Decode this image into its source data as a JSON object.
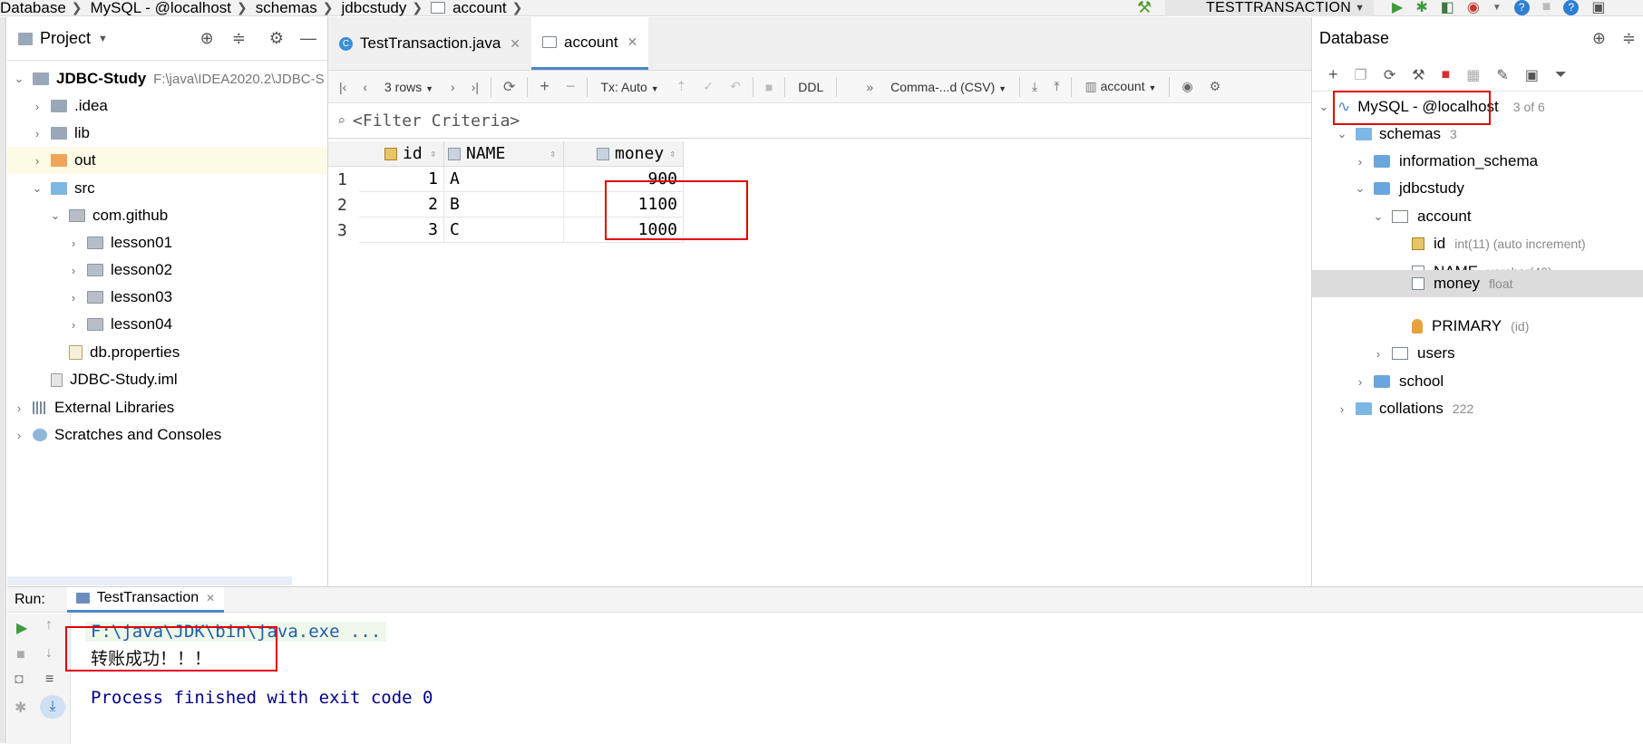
{
  "breadcrumb": [
    "Database",
    "MySQL - @localhost",
    "schemas",
    "jdbcstudy",
    "account"
  ],
  "run_config": {
    "name": "TESTTRANSACTION"
  },
  "project": {
    "title": "Project",
    "root": {
      "label": "JDBC-Study",
      "path": "F:\\java\\IDEA2020.2\\JDBC-S"
    },
    "items": [
      ".idea",
      "lib",
      "out",
      "src",
      "com.github",
      "lesson01",
      "lesson02",
      "lesson03",
      "lesson04",
      "db.properties",
      "JDBC-Study.iml",
      "External Libraries",
      "Scratches and Consoles"
    ]
  },
  "editor": {
    "tabs": [
      "TestTransaction.java",
      "account"
    ],
    "toolbar": {
      "rows": "3 rows",
      "tx": "Tx: Auto",
      "ddl": "DDL",
      "format": "Comma-...d (CSV)",
      "table": "account"
    },
    "filter_placeholder": "<Filter Criteria>",
    "columns": [
      "id",
      "NAME",
      "money"
    ],
    "rows": [
      {
        "n": "1",
        "id": "1",
        "name": "A",
        "money": "900"
      },
      {
        "n": "2",
        "id": "2",
        "name": "B",
        "money": "1100"
      },
      {
        "n": "3",
        "id": "3",
        "name": "C",
        "money": "1000"
      }
    ]
  },
  "database": {
    "title": "Database",
    "connection": "MySQL - @localhost",
    "conn_count": "3 of 6",
    "schemas": {
      "label": "schemas",
      "count": "3"
    },
    "information_schema": "information_schema",
    "jdbcstudy": "jdbcstudy",
    "account": "account",
    "columns": [
      {
        "name": "id",
        "type": "int(11) (auto increment)"
      },
      {
        "name": "NAME",
        "type": "varchar(40)"
      },
      {
        "name": "money",
        "type": "float"
      },
      {
        "name": "PRIMARY",
        "type": "(id)"
      }
    ],
    "users": "users",
    "school": "school",
    "collations": {
      "label": "collations",
      "count": "222"
    }
  },
  "run": {
    "label": "Run:",
    "tab": "TestTransaction",
    "lines": [
      "F:\\java\\JDK\\bin\\java.exe ...",
      "转账成功！！！",
      "Process finished with exit code 0"
    ]
  },
  "colors": {
    "accent": "#4a88c7",
    "highlight": "#e00000",
    "console_blue": "#00008b"
  }
}
